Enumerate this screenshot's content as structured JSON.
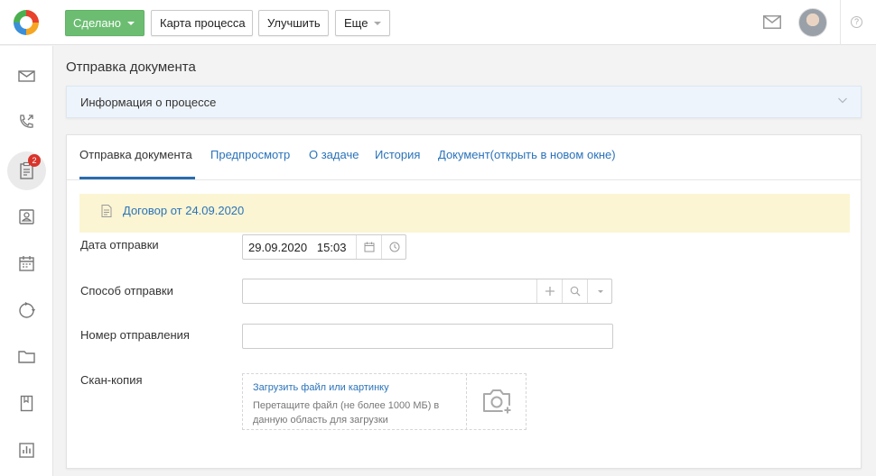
{
  "toolbar": {
    "done_label": "Сделано",
    "process_map_label": "Карта процесса",
    "improve_label": "Улучшить",
    "more_label": "Еще"
  },
  "sidebar": {
    "tasks_badge": "2"
  },
  "page": {
    "title": "Отправка документа",
    "info_panel_label": "Информация о процессе"
  },
  "tabs": [
    {
      "label": "Отправка документа"
    },
    {
      "label": "Предпросмотр"
    },
    {
      "label": "О задаче"
    },
    {
      "label": "История"
    },
    {
      "label": "Документ(открыть в новом окне)"
    }
  ],
  "document": {
    "link_text": "Договор от 24.09.2020"
  },
  "form": {
    "send_date_label": "Дата отправки",
    "send_date_value": "29.09.2020",
    "send_time_value": "15:03",
    "send_method_label": "Способ отправки",
    "send_method_value": "",
    "tracking_number_label": "Номер отправления",
    "tracking_number_value": "",
    "scan_label": "Скан-копия",
    "upload_link": "Загрузить файл или картинку",
    "upload_hint": "Перетащите файл (не более 1000 МБ) в данную область для загрузки"
  },
  "colors": {
    "done_button": "#6cbd72",
    "link": "#2a73ba",
    "tab_underline": "#2a6cb0",
    "banner": "#fbf5d3",
    "info_panel": "#eef4fb",
    "badge": "#d9342b"
  }
}
